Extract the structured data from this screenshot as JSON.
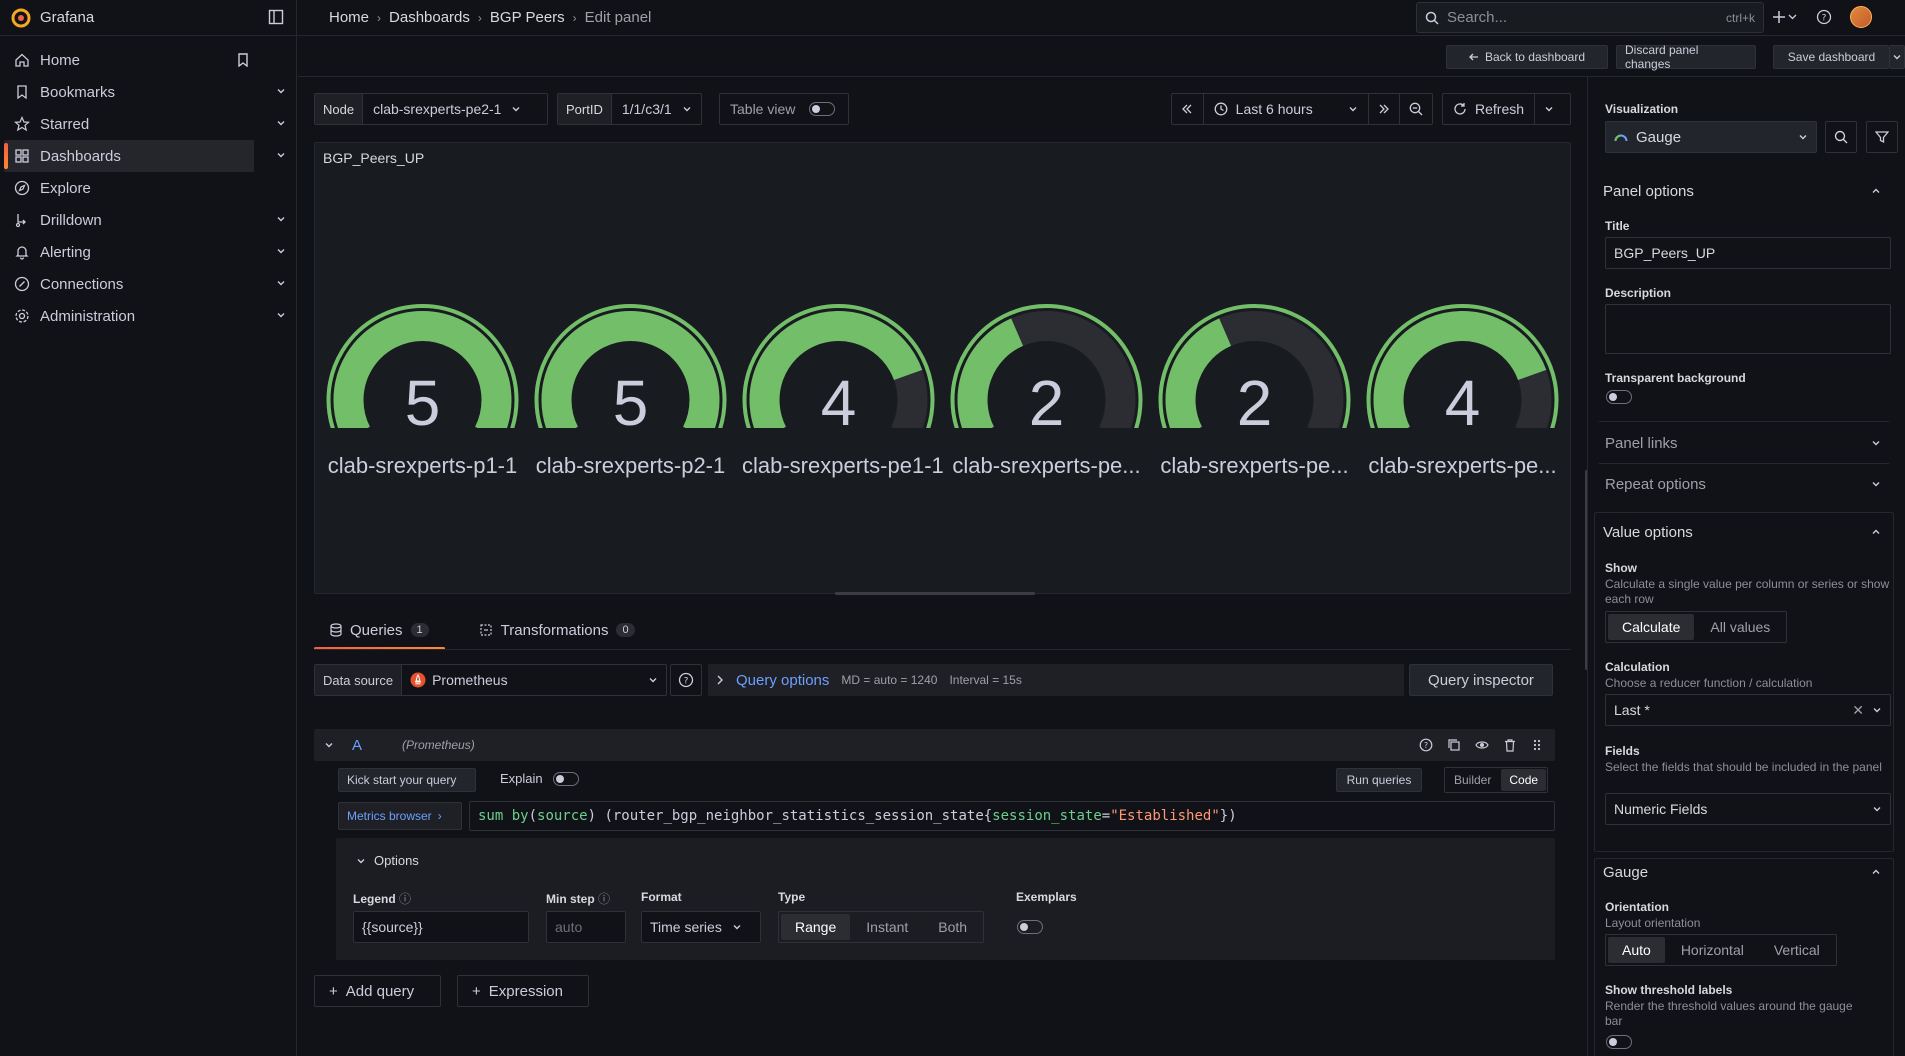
{
  "app": {
    "name": "Grafana",
    "accent": "#f55f3e"
  },
  "breadcrumb": [
    "Home",
    "Dashboards",
    "BGP Peers",
    "Edit panel"
  ],
  "search": {
    "placeholder": "Search...",
    "shortcut": "ctrl+k"
  },
  "sidebar": {
    "items": [
      {
        "label": "Home",
        "icon": "home-icon"
      },
      {
        "label": "Bookmarks",
        "icon": "bookmark-icon"
      },
      {
        "label": "Starred",
        "icon": "star-icon"
      },
      {
        "label": "Dashboards",
        "icon": "apps-icon",
        "active": true
      },
      {
        "label": "Explore",
        "icon": "compass-icon"
      },
      {
        "label": "Drilldown",
        "icon": "drilldown-icon"
      },
      {
        "label": "Alerting",
        "icon": "bell-icon"
      },
      {
        "label": "Connections",
        "icon": "link-icon"
      },
      {
        "label": "Administration",
        "icon": "cog-icon"
      }
    ]
  },
  "editbar": {
    "back": "Back to dashboard",
    "discard": "Discard panel changes",
    "save": "Save dashboard"
  },
  "variables": {
    "node_label": "Node",
    "node_value": "clab-srexperts-pe2-1",
    "port_label": "PortID",
    "port_value": "1/1/c3/1",
    "table_view": "Table view"
  },
  "timepicker": {
    "range": "Last 6 hours",
    "refresh": "Refresh"
  },
  "panel": {
    "title": "BGP_Peers_UP",
    "gauge_color": "#73bf69",
    "gauge_track": "#2b2d33",
    "gauge_max": 5,
    "gauges": [
      {
        "name": "clab-srexperts-p1-1",
        "value": 5
      },
      {
        "name": "clab-srexperts-p2-1",
        "value": 5
      },
      {
        "name": "clab-srexperts-pe1-1",
        "value": 4
      },
      {
        "name": "clab-srexperts-pe...",
        "value": 2
      },
      {
        "name": "clab-srexperts-pe...",
        "value": 2
      },
      {
        "name": "clab-srexperts-pe...",
        "value": 4
      }
    ]
  },
  "tabs": [
    {
      "label": "Queries",
      "count": "1"
    },
    {
      "label": "Transformations",
      "count": "0"
    }
  ],
  "datasource": {
    "label": "Data source",
    "value": "Prometheus",
    "query_options": "Query options",
    "md": "MD = auto = 1240",
    "interval": "Interval = 15s",
    "inspector": "Query inspector"
  },
  "query": {
    "ref": "A",
    "ds_note": "(Prometheus)",
    "kickstart": "Kick start your query",
    "explain": "Explain",
    "run": "Run queries",
    "builder": "Builder",
    "code": "Code",
    "metrics_browser": "Metrics browser",
    "expr": {
      "fn": "sum by",
      "p1": "(",
      "src": "source",
      "p2": ") (router_bgp_neighbor_statistics_session_state{",
      "lbl": "session_state",
      "eq": "=",
      "str": "\"Established\"",
      "end": "})"
    },
    "options_title": "Options",
    "legend_label": "Legend",
    "legend_value": "{{source}}",
    "minstep_label": "Min step",
    "minstep_placeholder": "auto",
    "format_label": "Format",
    "format_value": "Time series",
    "type_label": "Type",
    "type_options": [
      "Range",
      "Instant",
      "Both"
    ],
    "exemplars_label": "Exemplars"
  },
  "add": {
    "query": "Add query",
    "expression": "Expression"
  },
  "options_pane": {
    "viz_label": "Visualization",
    "viz_value": "Gauge",
    "panel_options": "Panel options",
    "title_label": "Title",
    "title_value": "BGP_Peers_UP",
    "desc_label": "Description",
    "transparent_label": "Transparent background",
    "panel_links": "Panel links",
    "repeat_options": "Repeat options",
    "value_options": "Value options",
    "show_label": "Show",
    "show_desc": "Calculate a single value per column or series or show each row",
    "show_options": [
      "Calculate",
      "All values"
    ],
    "calc_label": "Calculation",
    "calc_desc": "Choose a reducer function / calculation",
    "calc_value": "Last *",
    "fields_label": "Fields",
    "fields_desc": "Select the fields that should be included in the panel",
    "fields_value": "Numeric Fields",
    "gauge_section": "Gauge",
    "orientation_label": "Orientation",
    "orientation_desc": "Layout orientation",
    "orientation_options": [
      "Auto",
      "Horizontal",
      "Vertical"
    ],
    "threshold_labels_label": "Show threshold labels",
    "threshold_labels_desc": "Render the threshold values around the gauge bar"
  }
}
